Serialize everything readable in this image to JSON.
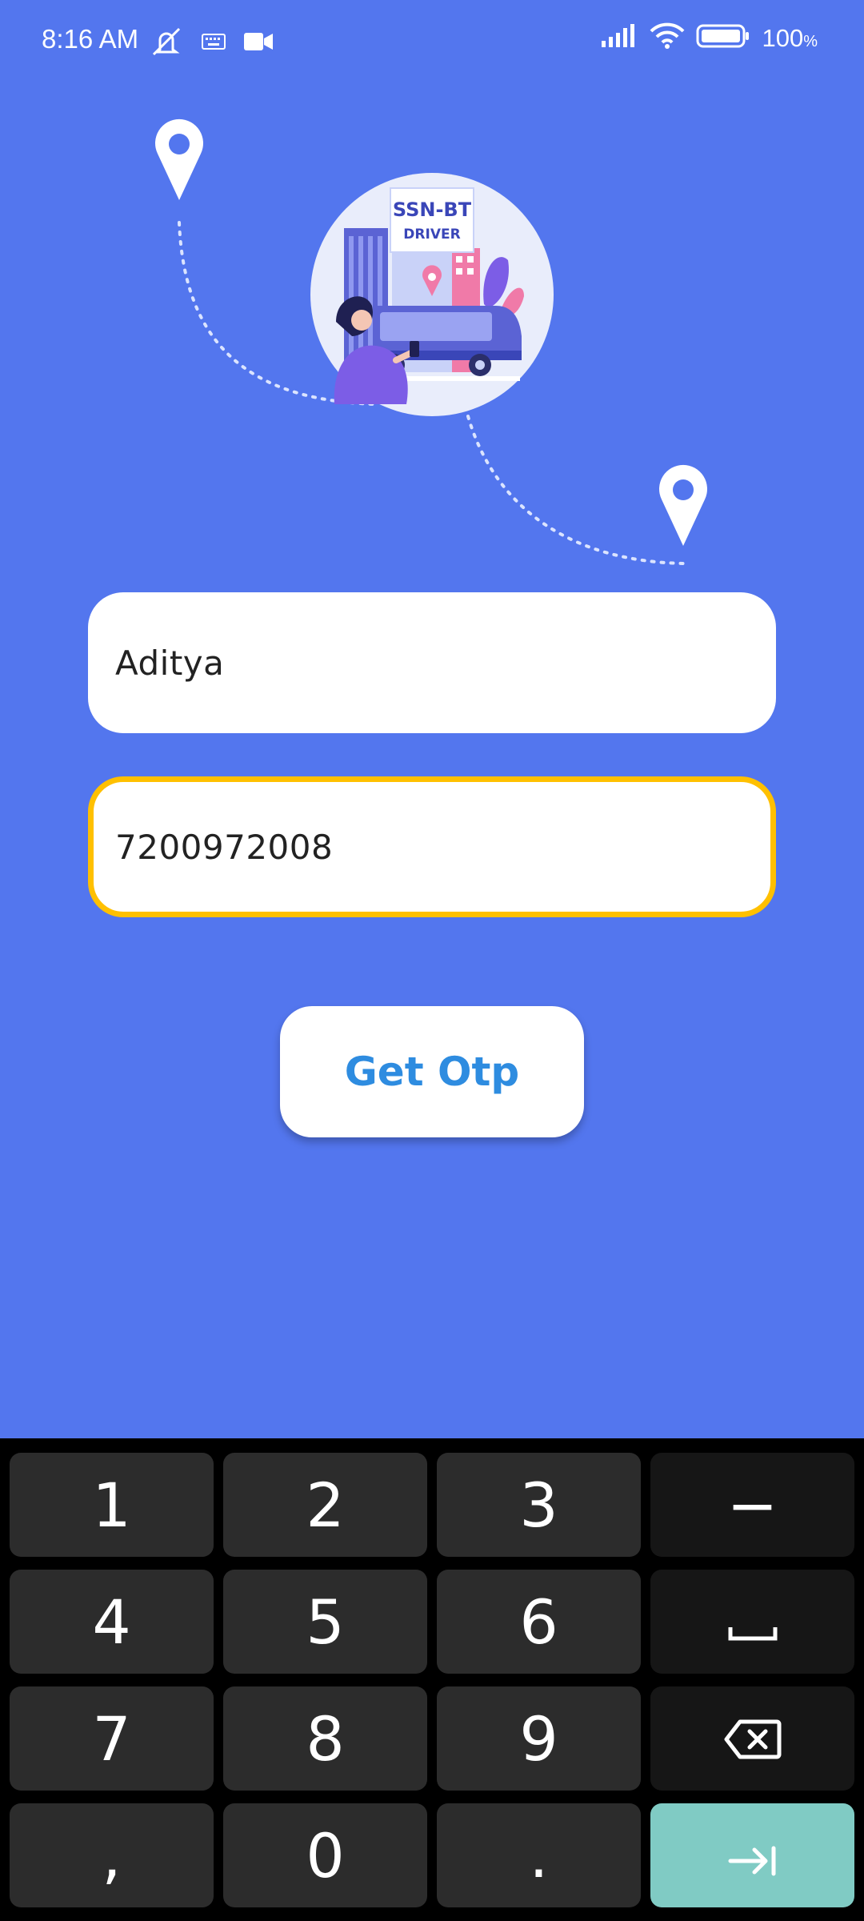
{
  "status_bar": {
    "time": "8:16 AM",
    "battery_percent": "100",
    "battery_unit": "%",
    "icons": [
      "mute-icon",
      "keyboard-icon",
      "video-camera-icon",
      "signal-icon",
      "wifi-icon",
      "battery-icon"
    ]
  },
  "illustration": {
    "logo_line1": "SSN-BT",
    "logo_line2": "DRIVER",
    "icons": [
      "location-pin-icon",
      "location-pin-icon"
    ]
  },
  "form": {
    "name_value": "Aditya",
    "phone_value": "7200972008",
    "submit_label": "Get Otp"
  },
  "colors": {
    "background": "#5376EE",
    "focus_border": "#FFC000",
    "button_text": "#2E8CE0",
    "enter_key": "#80CBC4"
  },
  "keyboard": {
    "keys": [
      [
        "1",
        "2",
        "3",
        "−"
      ],
      [
        "4",
        "5",
        "6",
        "␣"
      ],
      [
        "7",
        "8",
        "9",
        "⌫"
      ],
      [
        ",",
        "0",
        ".",
        "⇥"
      ]
    ]
  }
}
